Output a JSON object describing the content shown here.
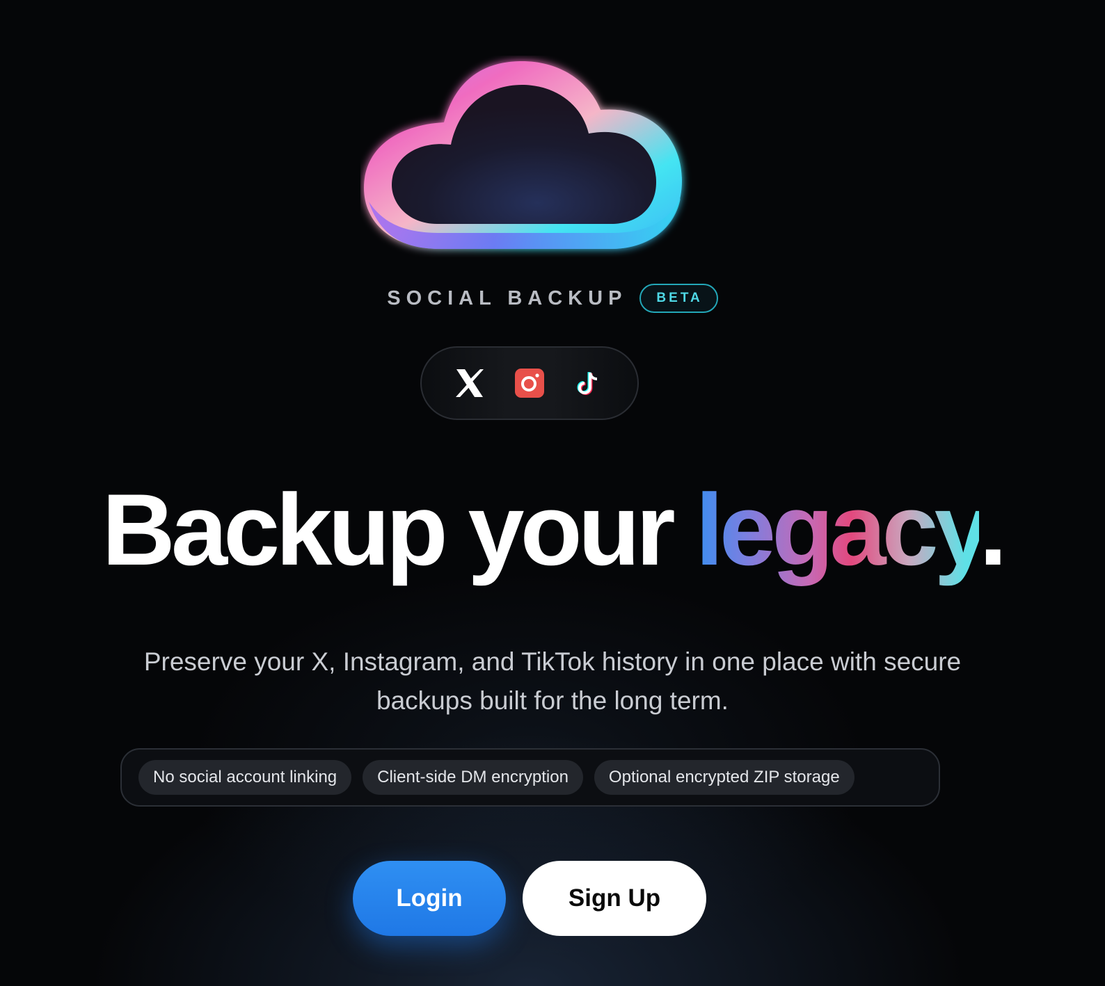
{
  "brand": {
    "name": "SOCIAL BACKUP",
    "badge": "BETA"
  },
  "platforms": [
    {
      "name": "X",
      "icon": "x-logo-icon"
    },
    {
      "name": "Instagram",
      "icon": "instagram-icon"
    },
    {
      "name": "TikTok",
      "icon": "tiktok-icon"
    }
  ],
  "hero": {
    "headline_main": "Backup your ",
    "headline_accent": "legacy",
    "headline_end": ".",
    "subtitle_line1": "Preserve your X, Instagram, and TikTok history in one place with secure",
    "subtitle_line2": "backups built for the long term."
  },
  "features": [
    "No social account linking",
    "Client-side DM encryption",
    "Optional encrypted ZIP storage"
  ],
  "actions": {
    "login": "Login",
    "signup": "Sign Up"
  },
  "colors": {
    "background": "#050608",
    "accent_blue": "#1f78e6",
    "beta_teal": "#4fd8e6"
  }
}
